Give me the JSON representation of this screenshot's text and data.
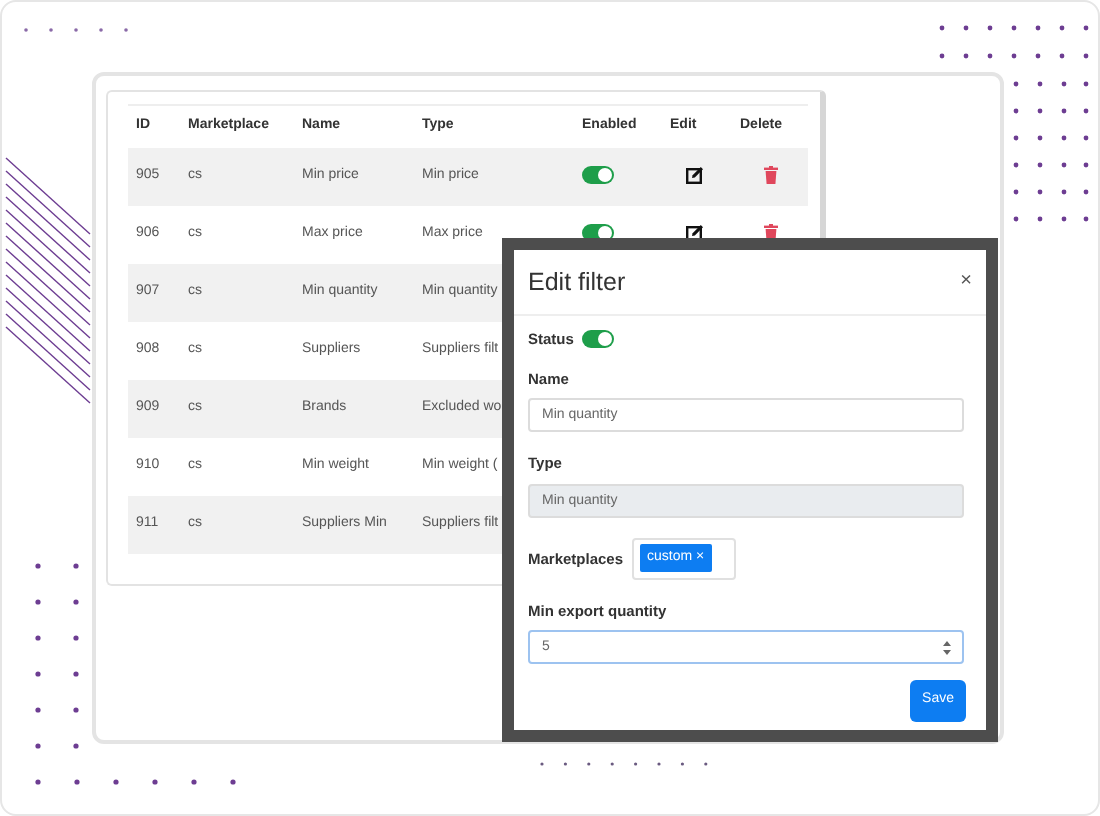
{
  "table": {
    "columns": [
      "ID",
      "Marketplace",
      "Name",
      "Type",
      "Enabled",
      "Edit",
      "Delete"
    ],
    "rows": [
      {
        "id": "905",
        "marketplace": "cs",
        "name": "Min price",
        "type": "Min price",
        "enabled": true
      },
      {
        "id": "906",
        "marketplace": "cs",
        "name": "Max price",
        "type": "Max price",
        "enabled": true
      },
      {
        "id": "907",
        "marketplace": "cs",
        "name": "Min quantity",
        "type": "Min quantity"
      },
      {
        "id": "908",
        "marketplace": "cs",
        "name": "Suppliers",
        "type": "Suppliers filt"
      },
      {
        "id": "909",
        "marketplace": "cs",
        "name": "Brands",
        "type": "Excluded wo"
      },
      {
        "id": "910",
        "marketplace": "cs",
        "name": "Min weight",
        "type": "Min weight ("
      },
      {
        "id": "911",
        "marketplace": "cs",
        "name": "Suppliers Min",
        "type": "Suppliers filt"
      }
    ]
  },
  "modal": {
    "title": "Edit filter",
    "close": "×",
    "status": {
      "label": "Status",
      "on": true
    },
    "fields": [
      {
        "kind": "text",
        "label": "Name",
        "value": "Min quantity",
        "disabled": false,
        "focused": false
      },
      {
        "kind": "text",
        "label": "Type",
        "value": "Min quantity",
        "disabled": true,
        "focused": false
      },
      {
        "kind": "tags",
        "label": "Marketplaces",
        "tags": [
          {
            "label": "custom",
            "remove": "×"
          }
        ]
      },
      {
        "kind": "number",
        "label": "Min export quantity",
        "value": "5",
        "disabled": false,
        "focused": true
      }
    ],
    "save": "Save"
  }
}
